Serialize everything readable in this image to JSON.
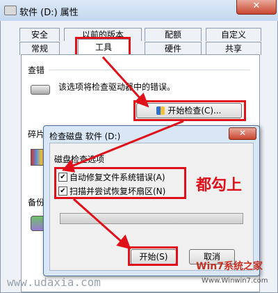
{
  "window": {
    "title": "软件 (D:) 属性",
    "close_label": "✕"
  },
  "tabs_row1": [
    "安全",
    "以前的版本",
    "配额",
    "自定义"
  ],
  "tabs_row2": [
    "常规",
    "工具",
    "硬件",
    "共享"
  ],
  "error_check": {
    "heading": "查错",
    "description": "该选项将检查驱动器中的错误。",
    "button_label": "开始检查(C)..."
  },
  "defrag": {
    "heading": "碎片"
  },
  "backup": {
    "heading": "备份"
  },
  "dialog": {
    "title": "检查磁盘 软件 (D:)",
    "close_label": "✕",
    "group_label": "磁盘检查选项",
    "options": [
      {
        "label": "自动修复文件系统错误(A)",
        "checked": true
      },
      {
        "label": "扫描并尝试恢复坏扇区(N)",
        "checked": true
      }
    ],
    "start_label": "开始(S)",
    "cancel_label": "取消"
  },
  "annotation": {
    "text": "都勾上",
    "color": "#e0101a"
  },
  "watermark": {
    "left_url": "www.udaxia.com",
    "right_logo": "Win7系统之家",
    "right_url": "Www.Winwin7.com"
  }
}
